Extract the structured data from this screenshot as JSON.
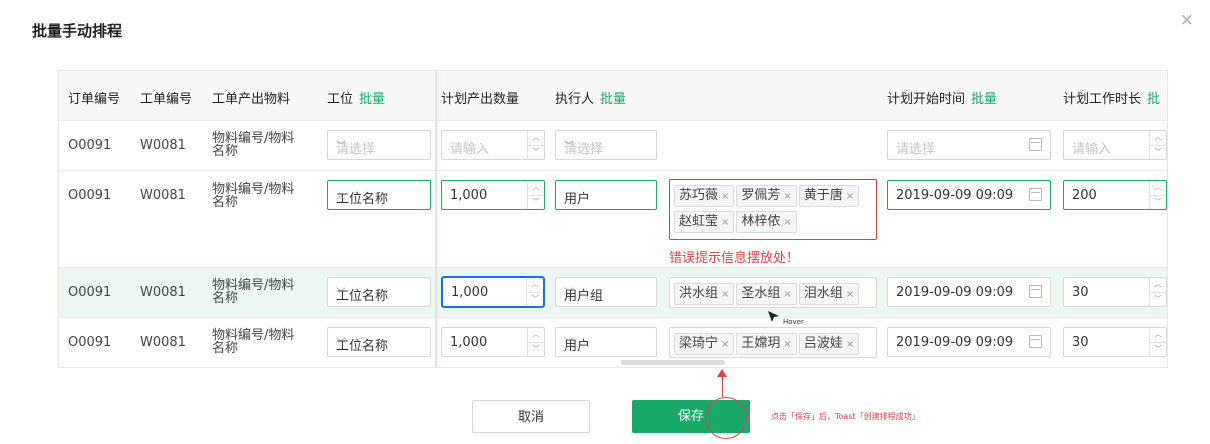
{
  "dialog": {
    "title": "批量手动排程",
    "close": "×"
  },
  "columns": {
    "order": "订单编号",
    "wo": "工单编号",
    "material": "工单产出物料",
    "station": "工位",
    "qty": "计划产出数量",
    "executor": "执行人",
    "start": "计划开始时间",
    "duration": "计划工作时长",
    "batch": "批量",
    "batch_clipped": "批"
  },
  "rows": [
    {
      "order": "O0091",
      "wo": "W0081",
      "material": "物料编号/物料名称",
      "station_placeholder": "请选择",
      "qty_placeholder": "请输入",
      "executor_placeholder": "请选择",
      "start_placeholder": "请选择",
      "duration_placeholder": "请输入"
    },
    {
      "order": "O0091",
      "wo": "W0081",
      "material": "物料编号/物料名称",
      "station": "工位名称",
      "qty": "1,000",
      "executor": "用户",
      "tags": [
        "苏巧薇",
        "罗佩芳",
        "黄于唐",
        "赵虹莹",
        "林梓侬"
      ],
      "error": "错误提示信息摆放处！",
      "start": "2019-09-09 09:09",
      "duration": "200"
    },
    {
      "order": "O0091",
      "wo": "W0081",
      "material": "物料编号/物料名称",
      "station": "工位名称",
      "qty": "1,000",
      "executor": "用户组",
      "tags": [
        "洪水组",
        "圣水组",
        "泪水组"
      ],
      "start": "2019-09-09 09:09",
      "duration": "30"
    },
    {
      "order": "O0091",
      "wo": "W0081",
      "material": "物料编号/物料名称",
      "station": "工位名称",
      "qty": "1,000",
      "executor": "用户",
      "tags": [
        "梁琦宁",
        "王嫦玥",
        "吕波娃"
      ],
      "start": "2019-09-09 09:09",
      "duration": "30"
    }
  ],
  "hover_label": "Hover",
  "footer": {
    "cancel": "取消",
    "save": "保存"
  },
  "annotation": "点击「保存」后，Toast「创建排程成功」",
  "colors": {
    "primary": "#19a96b",
    "error": "#e0424b",
    "focus": "#1474e6",
    "hover_row": "#ebf7f0"
  }
}
